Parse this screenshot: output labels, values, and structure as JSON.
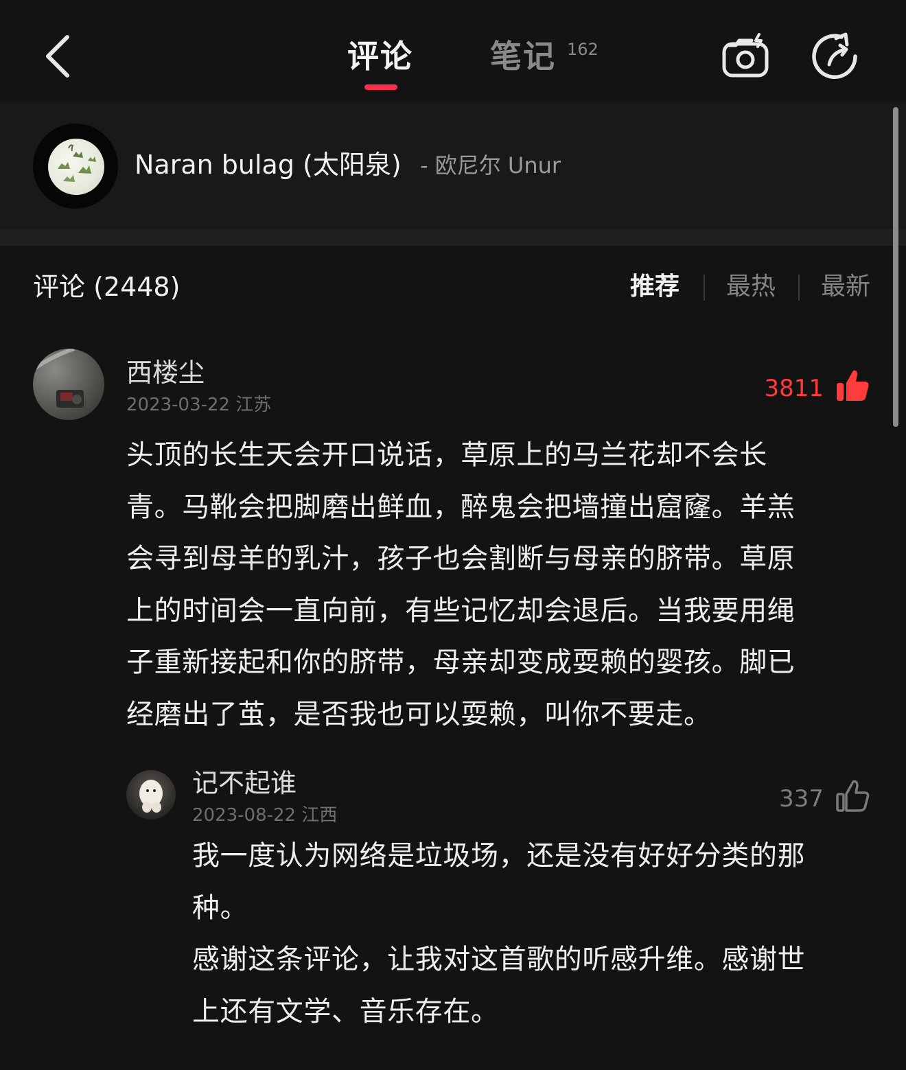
{
  "header": {
    "tab_comments": "评论",
    "tab_notes": "笔记",
    "tab_notes_count": "162",
    "accent": "#ff2e4d"
  },
  "song": {
    "title": "Naran bulag (太阳泉)",
    "artist": "- 欧尼尔 Unur"
  },
  "comments_section": {
    "label": "评论 (2448)",
    "sort_options": [
      "推荐",
      "最热",
      "最新"
    ],
    "active_sort": "推荐"
  },
  "comment": {
    "username": "西楼尘",
    "date": "2023-03-22",
    "location": "江苏",
    "likes": "3811",
    "liked": true,
    "like_color": "#ff3b3b",
    "lines": [
      "头顶的长生天会开口说话，草原上的马兰花却不会长",
      "青。马靴会把脚磨出鲜血，醉鬼会把墙撞出窟窿。羊羔",
      "会寻到母羊的乳汁，孩子也会割断与母亲的脐带。草原",
      "上的时间会一直向前，有些记忆却会退后。当我要用绳",
      "子重新接起和你的脐带，母亲却变成耍赖的婴孩。脚已",
      "经磨出了茧，是否我也可以耍赖，叫你不要走。"
    ]
  },
  "reply": {
    "username": "记不起谁",
    "date": "2023-08-22",
    "location": "江西",
    "likes": "337",
    "liked": false,
    "lines": [
      "我一度认为网络是垃圾场，还是没有好好分类的那",
      "种。",
      "感谢这条评论，让我对这首歌的听感升维。感谢世",
      "上还有文学、音乐存在。"
    ]
  },
  "icons": [
    "back-icon",
    "camera-icon",
    "share-icon",
    "thumbs-up-icon"
  ]
}
